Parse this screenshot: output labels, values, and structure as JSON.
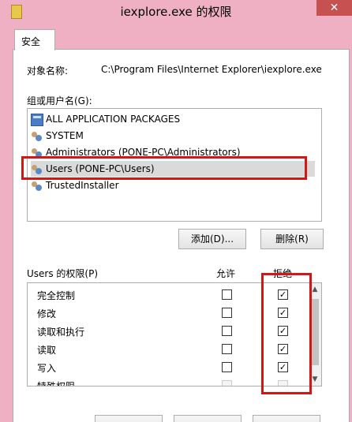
{
  "window": {
    "title": "iexplore.exe 的权限",
    "close_label": "✕"
  },
  "tab": {
    "label": "安全"
  },
  "object": {
    "label": "对象名称:",
    "path": "C:\\Program Files\\Internet Explorer\\iexplore.exe"
  },
  "groups": {
    "label": "组或用户名(G):",
    "items": [
      {
        "icon": "package-icon",
        "name": "ALL APPLICATION PACKAGES"
      },
      {
        "icon": "users-icon",
        "name": "SYSTEM"
      },
      {
        "icon": "users-icon",
        "name": "Administrators (PONE-PC\\Administrators)"
      },
      {
        "icon": "users-icon",
        "name": "Users (PONE-PC\\Users)"
      },
      {
        "icon": "users-icon",
        "name": "TrustedInstaller"
      }
    ],
    "selected_index": 3
  },
  "buttons": {
    "add": "添加(D)...",
    "remove": "删除(R)"
  },
  "permissions": {
    "label": "Users 的权限(P)",
    "allow_header": "允许",
    "deny_header": "拒绝",
    "rows": [
      {
        "name": "完全控制",
        "allow": false,
        "deny": true
      },
      {
        "name": "修改",
        "allow": false,
        "deny": true
      },
      {
        "name": "读取和执行",
        "allow": false,
        "deny": true
      },
      {
        "name": "读取",
        "allow": false,
        "deny": true
      },
      {
        "name": "写入",
        "allow": false,
        "deny": true
      },
      {
        "name": "特殊权限",
        "allow": false,
        "deny": false
      }
    ]
  },
  "colors": {
    "highlight": "#d01818",
    "close_button": "#c75050"
  }
}
